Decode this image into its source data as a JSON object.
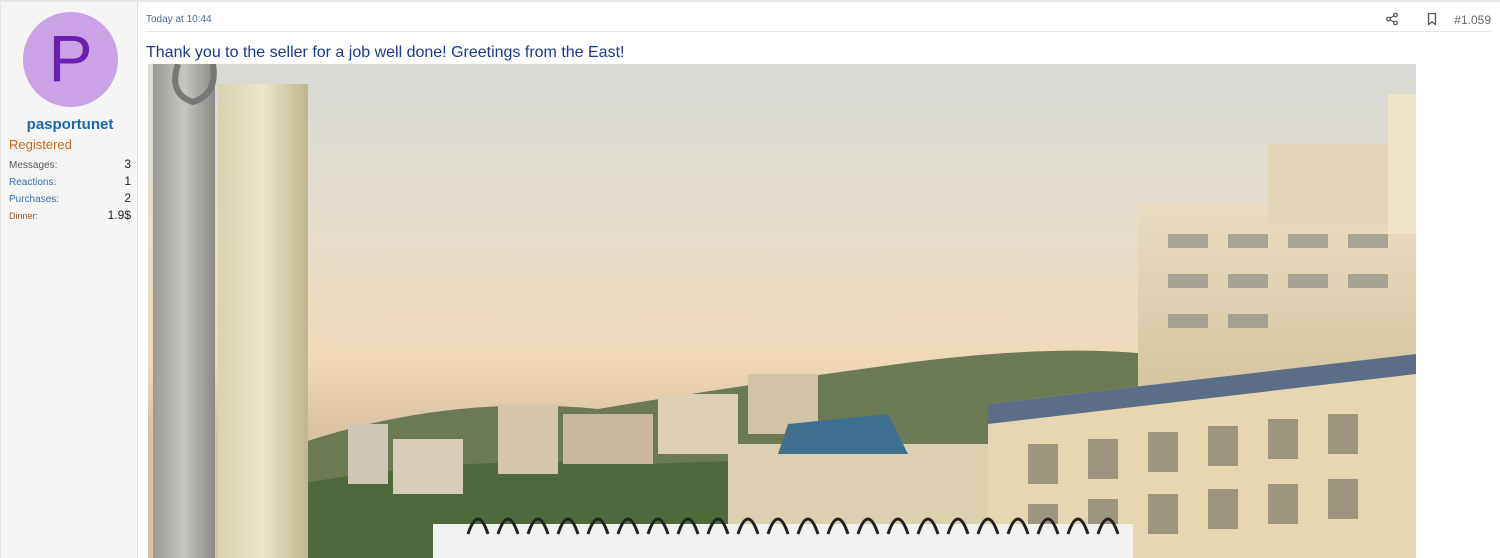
{
  "user": {
    "avatar_letter": "P",
    "username": "pasportunet",
    "title": "Registered",
    "stats": [
      {
        "label": "Messages:",
        "value": "3"
      },
      {
        "label": "Reactions:",
        "value": "1"
      },
      {
        "label": "Purchases:",
        "value": "2"
      },
      {
        "label": "Dinner:",
        "value": "1.9$"
      }
    ]
  },
  "post": {
    "timestamp": "Today at 10:44",
    "number": "#1.059",
    "message": "Thank you to the seller for a job well done! Greetings from the East!"
  },
  "colors": {
    "avatar_bg": "#c9a3e6",
    "avatar_letter": "#6a1fb0",
    "username": "#1b68b0",
    "user_title": "#c06a1e",
    "message_text": "#1c3a8a"
  },
  "icons": {
    "share": "share-icon",
    "bookmark": "bookmark-icon"
  }
}
